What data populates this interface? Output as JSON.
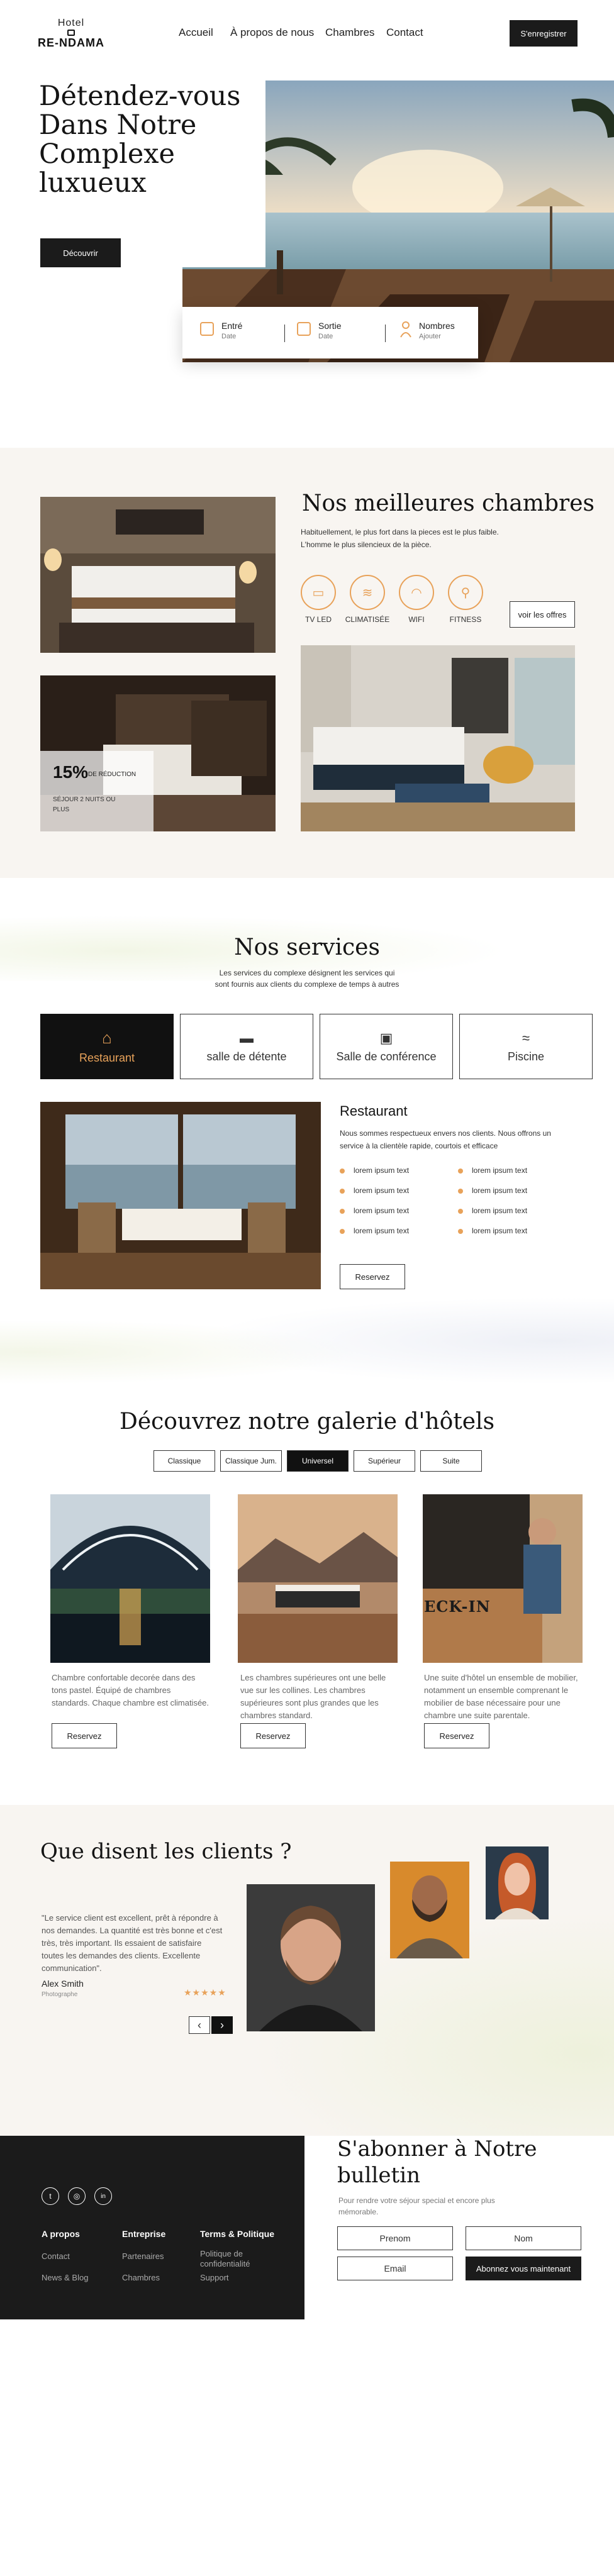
{
  "brand": {
    "line1": "Hotel",
    "line2": "RE-NDAMA"
  },
  "nav": {
    "items": [
      "Accueil",
      "À propos de nous",
      "Chambres",
      "Contact"
    ],
    "register": "S'enregistrer"
  },
  "hero": {
    "title": "Détendez-vous Dans Notre Complexe luxueux",
    "cta": "Découvrir"
  },
  "booking": [
    {
      "label": "Entré",
      "sub": "Date"
    },
    {
      "label": "Sortie",
      "sub": "Date"
    },
    {
      "label": "Nombres",
      "sub": "Ajouter"
    }
  ],
  "rooms": {
    "title": "Nos meilleures chambres",
    "desc": "Habituellement, le plus fort dans la pieces est le plus faible. L'homme le plus silencieux de la pièce.",
    "amenities": [
      "TV LED",
      "CLIMATISÉE",
      "WIFI",
      "FITNESS"
    ],
    "offers_button": "voir les offres",
    "promo_value": "15%",
    "promo_label": "DE RÉDUCTION",
    "promo_sub": "SÉJOUR 2 NUITS OU PLUS"
  },
  "services": {
    "title": "Nos services",
    "desc": "Les services du complexe désignent les services qui sont fournis aux clients du complexe de temps à autres",
    "tabs": [
      "Restaurant",
      "salle de détente",
      "Salle de conférence",
      "Piscine"
    ],
    "active_title": "Restaurant",
    "active_desc": "Nous sommes respectueux envers nos clients. Nous offrons un service à la clientèle rapide, courtois et efficace",
    "list_left": [
      "lorem ipsum text",
      "lorem ipsum text",
      "lorem ipsum text",
      "lorem ipsum text"
    ],
    "list_right": [
      "lorem ipsum text",
      "lorem ipsum text",
      "lorem ipsum text",
      "lorem ipsum text"
    ],
    "reserve": "Reservez"
  },
  "gallery": {
    "title": "Découvrez notre galerie d'hôtels",
    "tabs": [
      "Classique",
      "Classique Jum.",
      "Universel",
      "Supérieur",
      "Suite"
    ],
    "active_tab": "Universel",
    "cards": [
      {
        "text": "Chambre confortable decorée dans des tons pastel. Équipé de chambres standards. Chaque chambre est climatisée.",
        "button": "Reservez"
      },
      {
        "text": "Les chambres supérieures ont une belle vue sur les collines. Les chambres supérieures sont plus grandes que les chambres standard.",
        "button": "Reservez"
      },
      {
        "text": "Une suite d'hôtel un ensemble de mobilier, notamment un ensemble comprenant le mobilier de base nécessaire pour une chambre une suite parentale.",
        "button": "Reservez"
      }
    ],
    "checkin_sign": "ECK-IN"
  },
  "testimonials": {
    "title": "Que disent les clients ?",
    "quote": "\"Le service client est excellent, prêt à répondre à nos demandes. La quantité est très bonne et c'est très, très important. Ils essaient de satisfaire toutes les demandes des clients. Excellente communication\".",
    "name": "Alex Smith",
    "role": "Photographe",
    "stars": "★★★★★",
    "prev": "‹",
    "next": "›"
  },
  "footer": {
    "social": [
      "t",
      "◎",
      "in"
    ],
    "cols": [
      {
        "head": "A propos",
        "links": [
          "Contact",
          "News & Blog"
        ]
      },
      {
        "head": "Entreprise",
        "links": [
          "Partenaires",
          "Chambres"
        ]
      },
      {
        "head": "Terms & Politique",
        "links": [
          "Politique de confidentialité",
          "Support"
        ]
      }
    ]
  },
  "newsletter": {
    "title": "S'abonner à Notre bulletin",
    "desc": "Pour rendre votre séjour special et encore plus mémorable.",
    "prenom": "Prenom",
    "nom": "Nom",
    "email": "Email",
    "subscribe": "Abonnez vous maintenant"
  },
  "colors": {
    "accent": "#e8a25a",
    "dark": "#1b1b1b",
    "beige": "#f8f5f1"
  }
}
